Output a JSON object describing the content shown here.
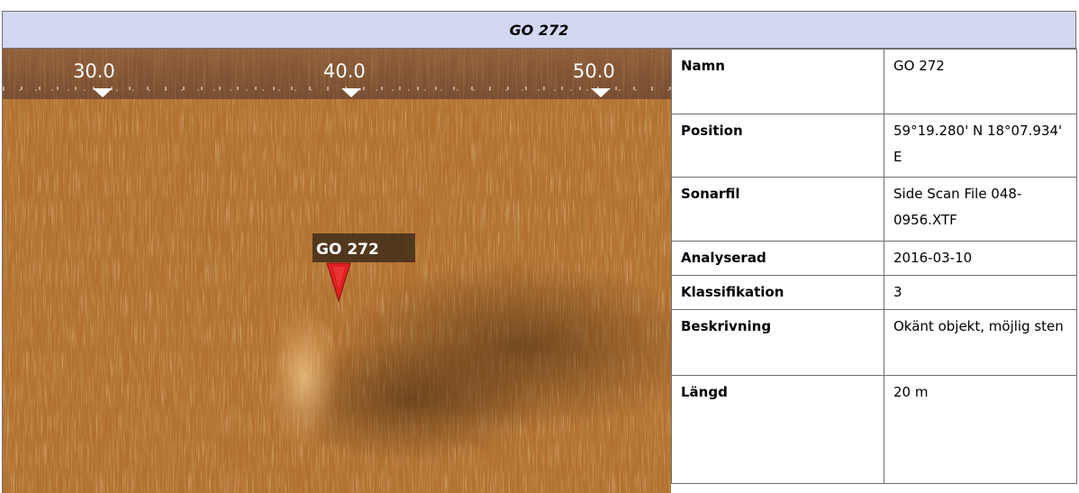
{
  "header": {
    "title": "GO 272"
  },
  "sonar_image": {
    "scale_labels": [
      "30.0",
      "40.0",
      "50.0"
    ],
    "marker_label": "GO 272",
    "colors": {
      "seabed": "#b2702f",
      "marker": "#e02020",
      "label_bg": "#3a2a18"
    }
  },
  "details": [
    {
      "key": "Namn",
      "value": "GO 272"
    },
    {
      "key": "Position",
      "value": "59°19.280' N 18°07.934' E"
    },
    {
      "key": "Sonarfil",
      "value": "Side Scan File 048-0956.XTF"
    },
    {
      "key": "Analyserad",
      "value": "2016-03-10"
    },
    {
      "key": "Klassifikation",
      "value": "3"
    },
    {
      "key": "Beskrivning",
      "value": "Okänt objekt, möjlig sten"
    },
    {
      "key": "Längd",
      "value": "20 m"
    }
  ]
}
